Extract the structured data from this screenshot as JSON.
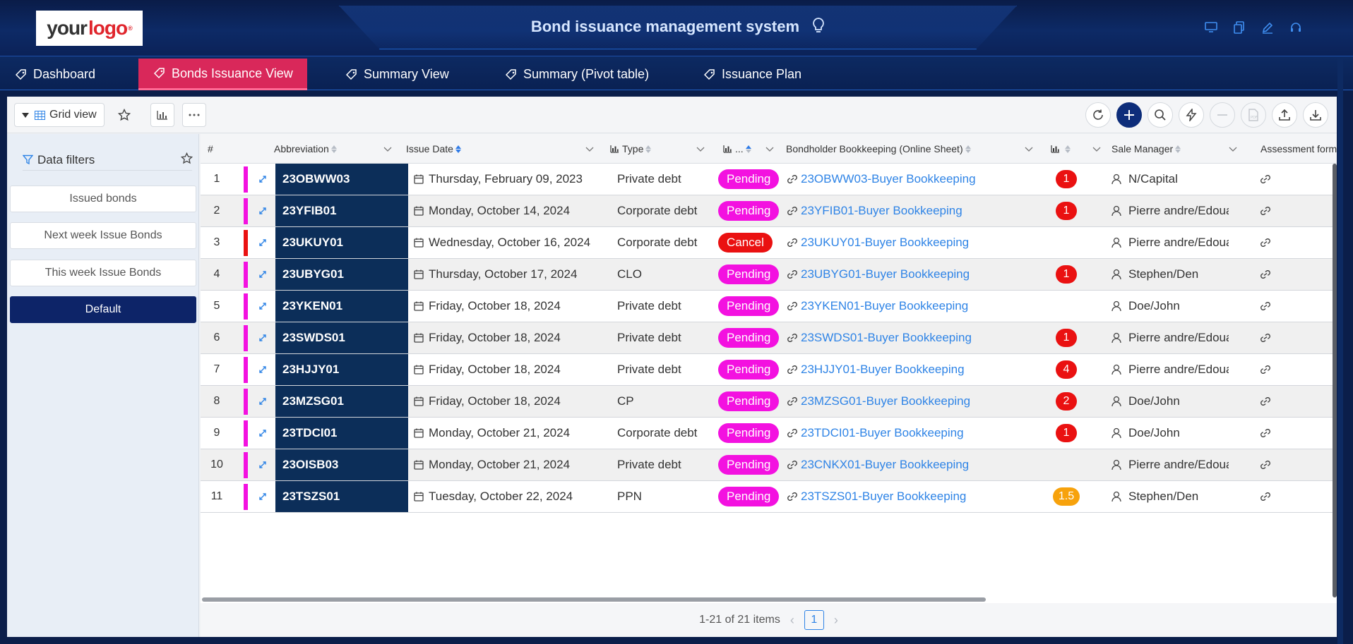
{
  "header": {
    "logo_word1": "your",
    "logo_word2": "logo",
    "logo_mark": "®",
    "title": "Bond issuance management system",
    "title_icon": "lightbulb-icon",
    "tools": [
      "monitor-icon",
      "copy-icon",
      "edit-icon",
      "headset-icon"
    ]
  },
  "tabs": [
    {
      "label": "Dashboard",
      "active": false
    },
    {
      "label": "Bonds Issuance View",
      "active": true
    },
    {
      "label": "Summary View",
      "active": false
    },
    {
      "label": "Summary (Pivot table)",
      "active": false
    },
    {
      "label": "Issuance Plan",
      "active": false
    }
  ],
  "toolbar": {
    "view_label": "Grid view",
    "actions_right": [
      "refresh-icon",
      "add-icon",
      "search-icon",
      "flash-icon",
      "minus-icon",
      "pdf-icon",
      "upload-icon",
      "download-icon"
    ]
  },
  "sidebar": {
    "title": "Data filters",
    "filters": [
      {
        "label": "Issued bonds",
        "active": false
      },
      {
        "label": "Next week Issue Bonds",
        "active": false
      },
      {
        "label": "This week Issue Bonds",
        "active": false
      },
      {
        "label": "Default",
        "active": true
      }
    ]
  },
  "columns": {
    "num": "#",
    "abbreviation": "Abbreviation",
    "issue_date": "Issue Date",
    "type": "Type",
    "status": "...",
    "bookkeeping": "Bondholder Bookkeeping (Online Sheet)",
    "sale_manager": "Sale Manager",
    "assessment": "Assessment form"
  },
  "rows": [
    {
      "n": "1",
      "abbr": "23OBWW03",
      "date": "Thursday, February 09, 2023",
      "type": "Private debt",
      "status": "Pending",
      "book": "23OBWW03-Buyer Bookkeeping",
      "count": "1",
      "manager": "N/Capital",
      "bar": "#f311e0"
    },
    {
      "n": "2",
      "abbr": "23YFIB01",
      "date": "Monday, October 14, 2024",
      "type": "Corporate debt",
      "status": "Pending",
      "book": "23YFIB01-Buyer Bookkeeping",
      "count": "1",
      "manager": "Pierre andre/Edouard",
      "bar": "#f311e0"
    },
    {
      "n": "3",
      "abbr": "23UKUY01",
      "date": "Wednesday, October 16, 2024",
      "type": "Corporate debt",
      "status": "Cancel",
      "book": "23UKUY01-Buyer Bookkeeping",
      "count": "",
      "manager": "Pierre andre/Edouard",
      "bar": "#ea1111"
    },
    {
      "n": "4",
      "abbr": "23UBYG01",
      "date": "Thursday, October 17, 2024",
      "type": "CLO",
      "status": "Pending",
      "book": "23UBYG01-Buyer Bookkeeping",
      "count": "1",
      "manager": "Stephen/Den",
      "bar": "#f311e0"
    },
    {
      "n": "5",
      "abbr": "23YKEN01",
      "date": "Friday, October 18, 2024",
      "type": "Private debt",
      "status": "Pending",
      "book": "23YKEN01-Buyer Bookkeeping",
      "count": "",
      "manager": "Doe/John",
      "bar": "#f311e0"
    },
    {
      "n": "6",
      "abbr": "23SWDS01",
      "date": "Friday, October 18, 2024",
      "type": "Private debt",
      "status": "Pending",
      "book": "23SWDS01-Buyer Bookkeeping",
      "count": "1",
      "manager": "Pierre andre/Edouard",
      "bar": "#f311e0"
    },
    {
      "n": "7",
      "abbr": "23HJJY01",
      "date": "Friday, October 18, 2024",
      "type": "Private debt",
      "status": "Pending",
      "book": "23HJJY01-Buyer Bookkeeping",
      "count": "4",
      "manager": "Pierre andre/Edouard",
      "bar": "#f311e0"
    },
    {
      "n": "8",
      "abbr": "23MZSG01",
      "date": "Friday, October 18, 2024",
      "type": "CP",
      "status": "Pending",
      "book": "23MZSG01-Buyer Bookkeeping",
      "count": "2",
      "manager": "Doe/John",
      "bar": "#f311e0"
    },
    {
      "n": "9",
      "abbr": "23TDCI01",
      "date": "Monday, October 21, 2024",
      "type": "Corporate debt",
      "status": "Pending",
      "book": "23TDCI01-Buyer Bookkeeping",
      "count": "1",
      "manager": "Doe/John",
      "bar": "#f311e0"
    },
    {
      "n": "10",
      "abbr": "23OISB03",
      "date": "Monday, October 21, 2024",
      "type": "Private debt",
      "status": "Pending",
      "book": "23CNKX01-Buyer Bookkeeping",
      "count": "",
      "manager": "Pierre andre/Edouard",
      "bar": "#f311e0"
    },
    {
      "n": "11",
      "abbr": "23TSZS01",
      "date": "Tuesday, October 22, 2024",
      "type": "PPN",
      "status": "Pending",
      "book": "23TSZS01-Buyer Bookkeeping",
      "count": "1.5",
      "manager": "Stephen/Den",
      "bar": "#f311e0",
      "count_color": "orange"
    }
  ],
  "pagination": {
    "summary": "1-21 of 21 items",
    "current_page": "1",
    "prev": "‹",
    "next": "›"
  },
  "colors": {
    "header_bg": "#0b1e4a",
    "tab_active": "#d9285a",
    "pending": "#f311e0",
    "cancel": "#ea1111",
    "link": "#2f84e6",
    "abbr_cell": "#0c2e59",
    "default_filter": "#0d2468"
  }
}
